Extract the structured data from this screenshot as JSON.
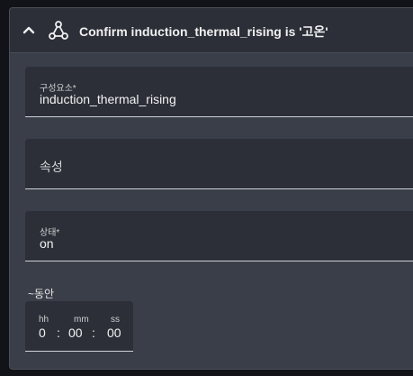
{
  "header": {
    "title": "Confirm induction_thermal_rising is '고온'",
    "collapse_icon": "chevron-up-icon",
    "type_icon": "condition-node-icon"
  },
  "fields": {
    "entity": {
      "label": "구성요소*",
      "value": "induction_thermal_rising"
    },
    "attribute": {
      "placeholder": "속성"
    },
    "state": {
      "label": "상태*",
      "value": "on"
    }
  },
  "duration": {
    "label": "~동안",
    "units": {
      "hours": "hh",
      "minutes": "mm",
      "seconds": "ss"
    },
    "values": {
      "hours": "0",
      "minutes": "00",
      "seconds": "00"
    },
    "separator": ":"
  },
  "colors": {
    "card_bg": "#3a3e48",
    "field_bg": "#2c2f38",
    "underline": "#cfd2d8",
    "page_bg": "#111318"
  }
}
